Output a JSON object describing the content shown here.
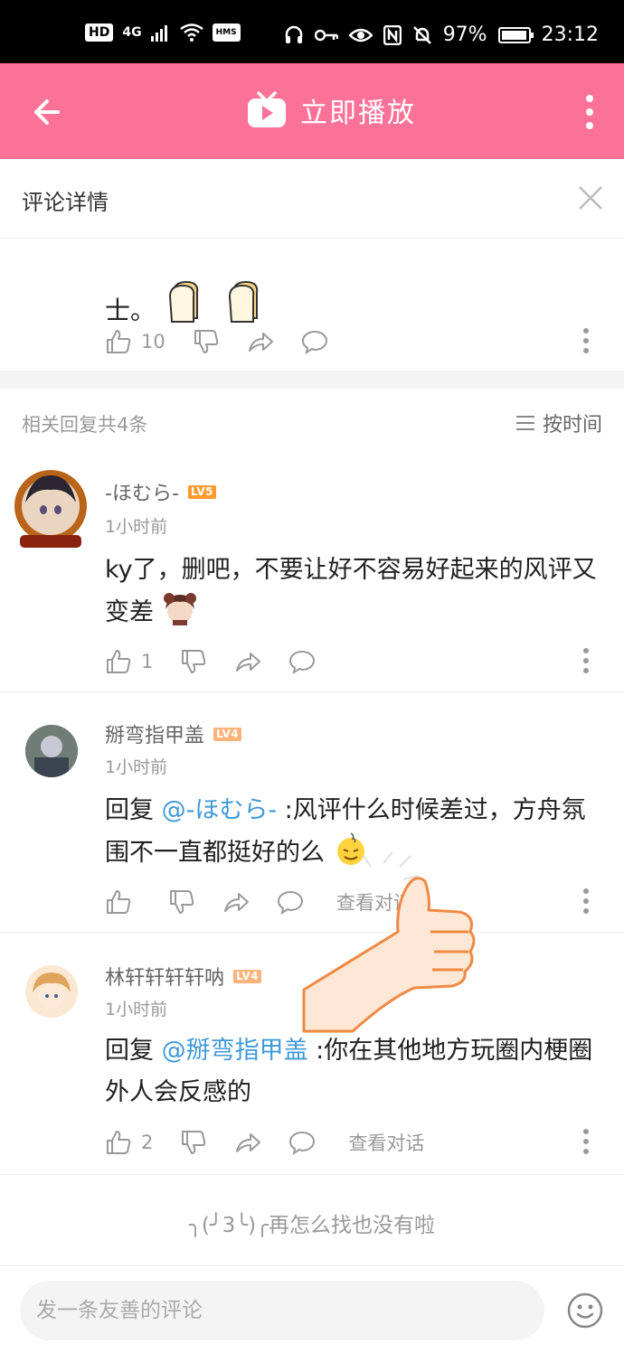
{
  "status_bar": {
    "left_chip_1": "HD",
    "signal": "4G",
    "chip_2": "HMS",
    "battery": "97%",
    "time": "23:12"
  },
  "app_bar": {
    "title": "立即播放"
  },
  "detail": {
    "title": "评论详情"
  },
  "parent_comment": {
    "tail_text": "士。",
    "like_count": "10"
  },
  "replies_header": {
    "count_text": "相关回复共4条",
    "sort_label": "按时间"
  },
  "replies": [
    {
      "user": "-ほむら-",
      "level": "LV5",
      "time": "1小时前",
      "text_a": "ky了，删吧，不要让好不容易好起来的风评又变差",
      "likes": "1"
    },
    {
      "user": "掰弯指甲盖",
      "level": "LV4",
      "time": "1小时前",
      "prefix": "回复 ",
      "mention": "@-ほむら-",
      "text_b": " :风评什么时候差过，方舟氛围不一直都挺好的么",
      "likes": "",
      "view_conv": "查看对话"
    },
    {
      "user": "林轩轩轩轩呐",
      "level": "LV4",
      "time": "1小时前",
      "prefix": "回复 ",
      "mention": "@掰弯指甲盖",
      "text_b": " :你在其他地方玩圈内梗圈外人会反感的",
      "likes": "2",
      "view_conv": "查看对话"
    }
  ],
  "end_note": "╮(╯3╰)╭再怎么找也没有啦",
  "composer": {
    "placeholder": "发一条友善的评论"
  },
  "colors": {
    "accent": "#fb7299",
    "mention": "#3f9ad8",
    "lv5": "#ff9a2e",
    "lv4": "#ffb27a"
  }
}
